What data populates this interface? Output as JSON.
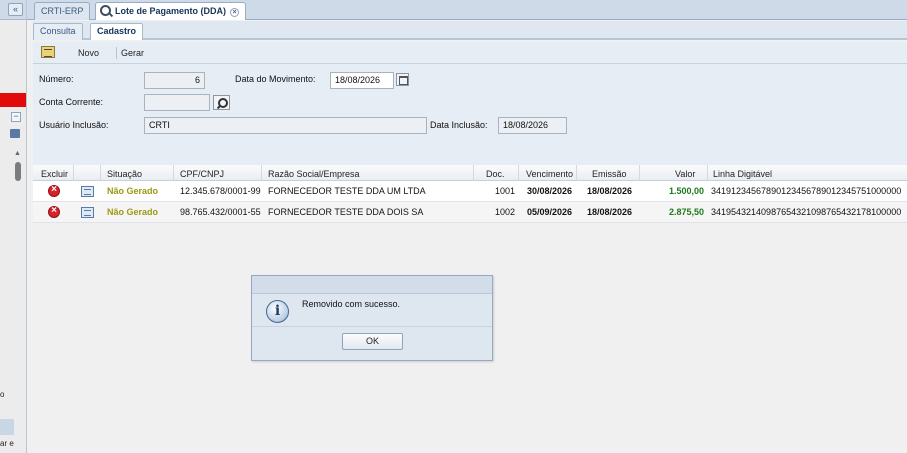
{
  "tabs": {
    "erp_label": "CRTI-ERP",
    "lote_label": "Lote de Pagamento (DDA)"
  },
  "subtabs": {
    "consulta": "Consulta",
    "cadastro": "Cadastro"
  },
  "toolbar": {
    "novo": "Novo",
    "gerar": "Gerar"
  },
  "form": {
    "numero_label": "Número:",
    "numero_value": "6",
    "data_movimento_label": "Data do Movimento:",
    "data_movimento_value": "18/08/2026",
    "conta_corrente_label": "Conta Corrente:",
    "conta_corrente_value": "",
    "usuario_inclusao_label": "Usuário Inclusão:",
    "usuario_inclusao_value": "CRTI",
    "data_inclusao_label": "Data Inclusão:",
    "data_inclusao_value": "18/08/2026"
  },
  "grid": {
    "headers": {
      "excluir": "Excluir",
      "situacao": "Situação",
      "cpf": "CPF/CNPJ",
      "razao": "Razão Social/Empresa",
      "doc": "Doc.",
      "vencimento": "Vencimento",
      "emissao": "Emissão",
      "valor": "Valor",
      "linha": "Linha Digitável"
    },
    "rows": [
      {
        "situacao": "Não Gerado",
        "cpf": "12.345.678/0001-99",
        "razao": "FORNECEDOR TESTE DDA UM LTDA",
        "doc": "1001",
        "vencimento": "30/08/2026",
        "emissao": "18/08/2026",
        "valor": "1.500,00",
        "linha": "34191234567890123456789012345751000000"
      },
      {
        "situacao": "Não Gerado",
        "cpf": "98.765.432/0001-55",
        "razao": "FORNECEDOR TESTE DDA DOIS SA",
        "doc": "1002",
        "vencimento": "05/09/2026",
        "emissao": "18/08/2026",
        "valor": "2.875,50",
        "linha": "34195432140987654321098765432178100000"
      }
    ]
  },
  "dialog": {
    "message": "Removido com sucesso.",
    "ok_label": "OK"
  },
  "left_panel": {
    "collapse_glyph": "«",
    "minus_glyph": "−",
    "scroll_arrow_glyph": "▲",
    "text1": "o",
    "text2": "ar e"
  },
  "colors": {
    "status_text": "#9a9a14",
    "valor_text": "#1c7a1c",
    "delete_icon": "#d9232a",
    "left_red_bar": "#e10b0b"
  }
}
